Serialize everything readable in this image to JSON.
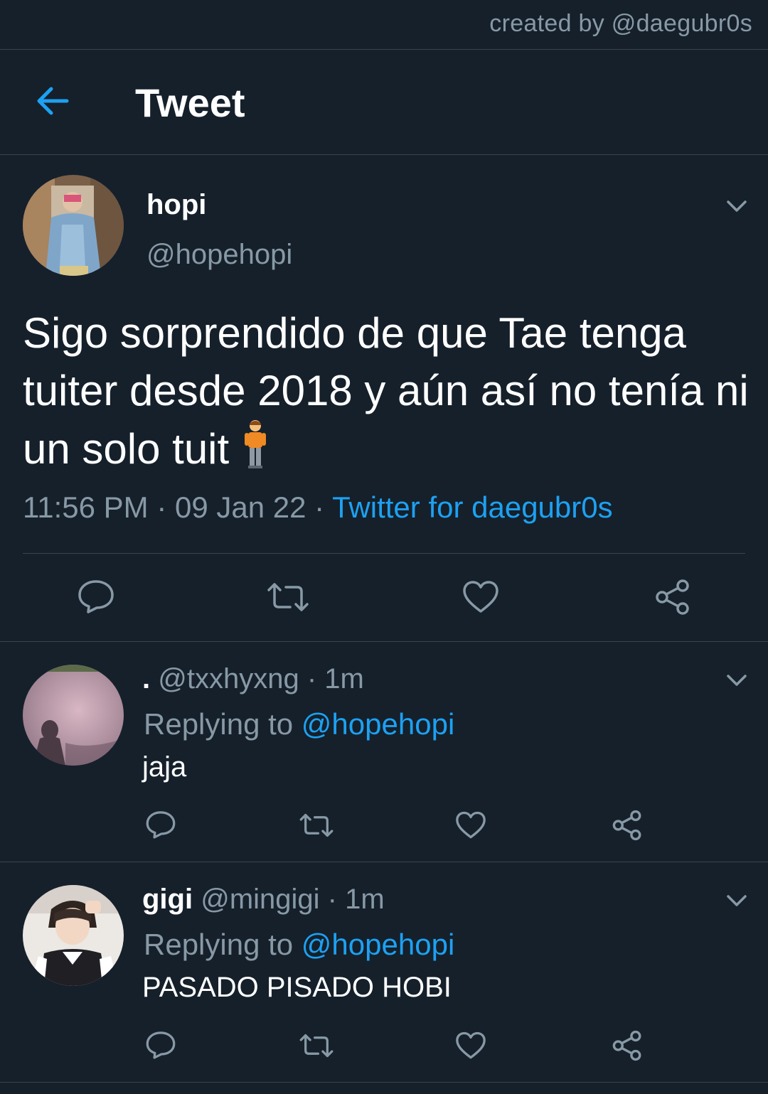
{
  "credit": "created by @daegubr0s",
  "header": {
    "title": "Tweet"
  },
  "main_tweet": {
    "name": "hopi",
    "handle": "@hopehopi",
    "text": "Sigo sorprendido de que Tae tenga tuiter desde 2018 y aún así no tenía ni un solo tuit",
    "emoji": "🧍",
    "time": "11:56 PM",
    "date": "09 Jan 22",
    "separator": "·",
    "client": "Twitter for daegubr0s"
  },
  "replies": [
    {
      "name": ".",
      "handle": "@txxhyxng",
      "age": "1m",
      "replying_label": "Replying to",
      "replying_to": "@hopehopi",
      "text": "jaja"
    },
    {
      "name": "gigi",
      "handle": "@mingigi",
      "age": "1m",
      "replying_label": "Replying to",
      "replying_to": "@hopehopi",
      "text": "PASADO PISADO HOBI"
    }
  ],
  "icons": {
    "back": "back-arrow-icon",
    "menu": "chevron-down-icon",
    "reply": "reply-icon",
    "retweet": "retweet-icon",
    "like": "heart-icon",
    "share": "share-icon"
  },
  "colors": {
    "background": "#15202b",
    "accent": "#1da1f2",
    "secondary_text": "#8899a6",
    "divider": "#38444d"
  }
}
